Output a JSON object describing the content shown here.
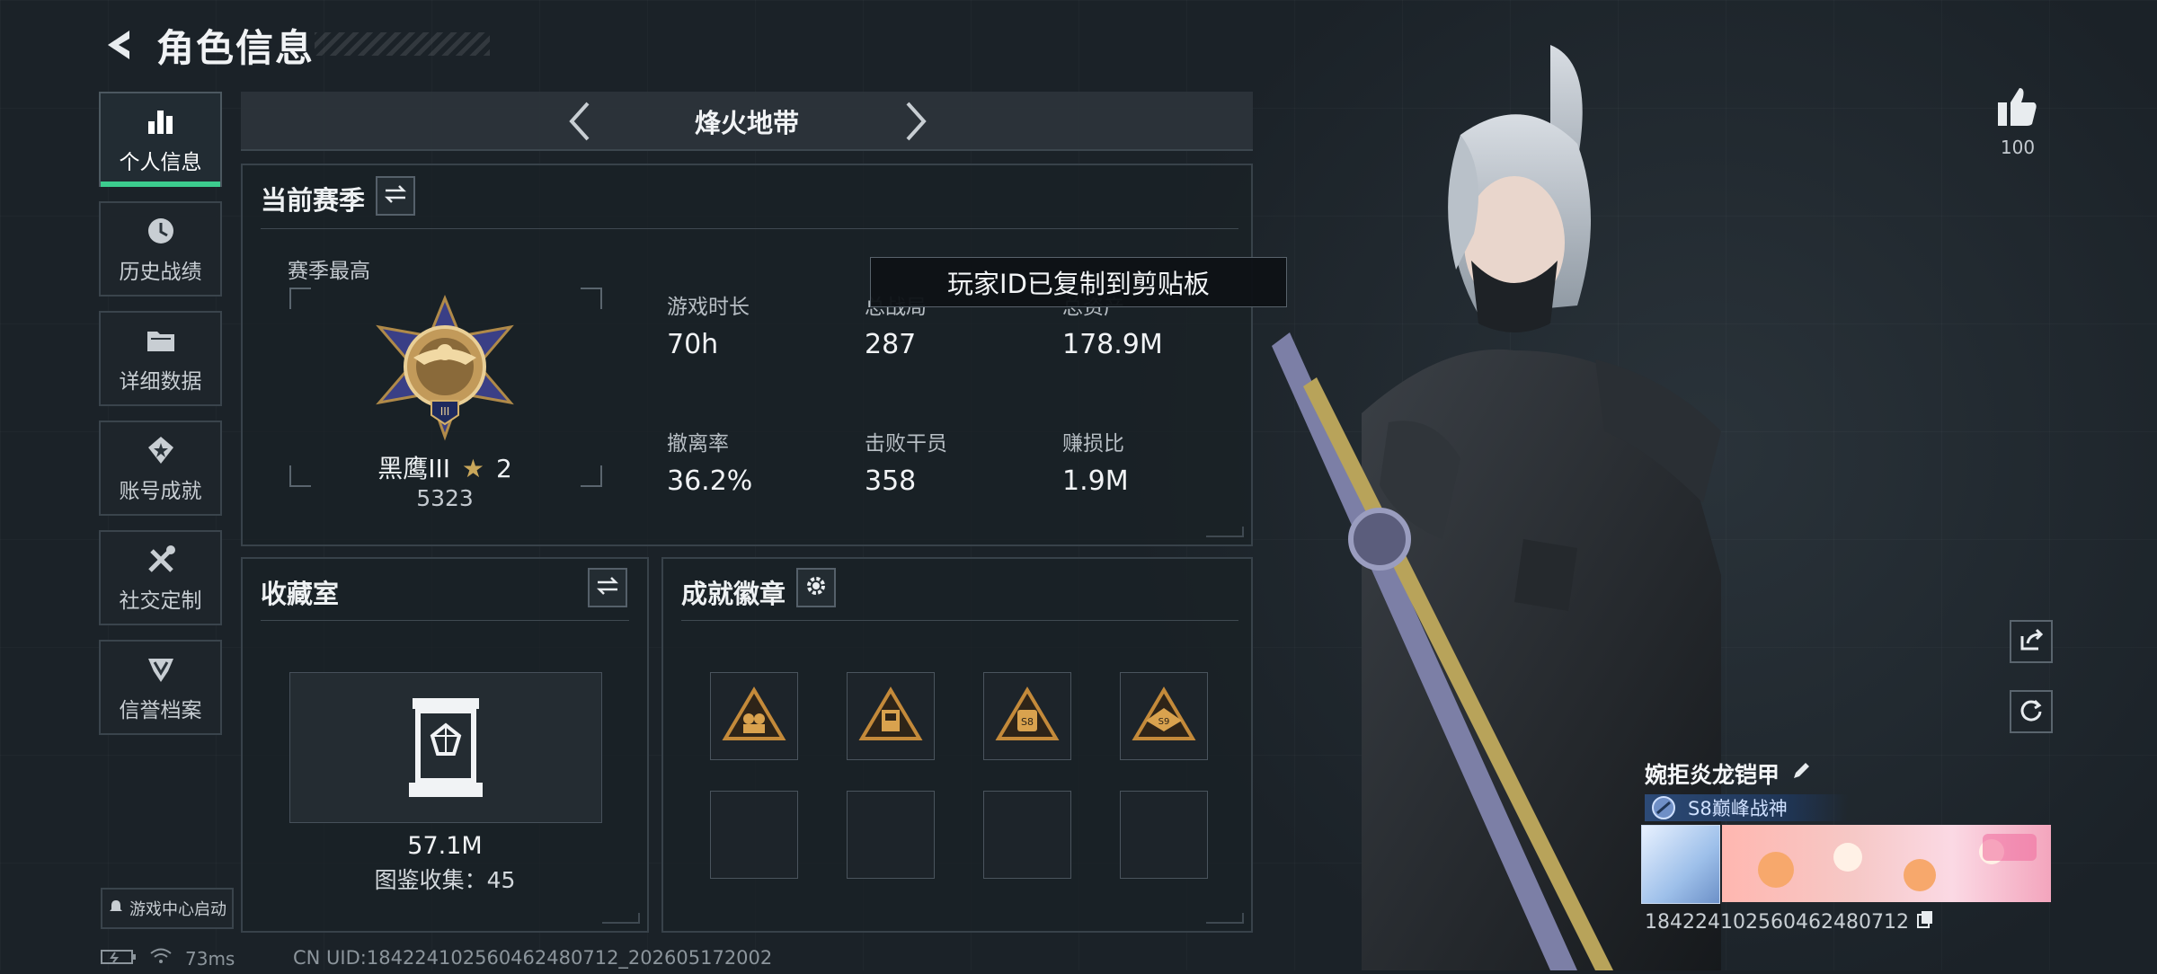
{
  "header": {
    "title": "角色信息"
  },
  "nav": {
    "items": [
      {
        "label": "个人信息",
        "icon": "bar-chart-icon",
        "active": true
      },
      {
        "label": "历史战绩",
        "icon": "history-icon"
      },
      {
        "label": "详细数据",
        "icon": "folder-icon"
      },
      {
        "label": "账号成就",
        "icon": "achievement-icon"
      },
      {
        "label": "社交定制",
        "icon": "tools-icon"
      },
      {
        "label": "信誉档案",
        "icon": "reputation-icon"
      }
    ],
    "launch_label": "游戏中心启动"
  },
  "mode_selector": {
    "title": "烽火地带"
  },
  "season_panel": {
    "title": "当前赛季",
    "season_best_label": "赛季最高",
    "rank_name": "黑鹰III",
    "rank_stars": "2",
    "rank_score": "5323",
    "stats": [
      {
        "label": "游戏时长",
        "value": "70h"
      },
      {
        "label": "总战局",
        "value": "287"
      },
      {
        "label": "总资产",
        "value": "178.9M"
      },
      {
        "label": "撤离率",
        "value": "36.2%"
      },
      {
        "label": "击败干员",
        "value": "358"
      },
      {
        "label": "赚损比",
        "value": "1.9M"
      }
    ]
  },
  "toast": {
    "message": "玩家ID已复制到剪贴板"
  },
  "collection_panel": {
    "title": "收藏室",
    "value": "57.1M",
    "count_text": "图鉴收集：45"
  },
  "badges_panel": {
    "title": "成就徽章",
    "badges": [
      "badge-squad-icon",
      "badge-s4-icon",
      "badge-s8-icon",
      "badge-s9-icon"
    ]
  },
  "profile": {
    "likes": "100",
    "skin_name": "婉拒炎龙铠甲",
    "title_tag": "S8巅峰战神",
    "uid_text": "1842241025604624807​12"
  },
  "status": {
    "ping": "73ms",
    "cn_uid": "CN UID:184224102560462480712_202605172002"
  },
  "colors": {
    "accent": "#3ccc8e",
    "panel_border": "#38424a",
    "title_tag": "#2c4a77"
  }
}
